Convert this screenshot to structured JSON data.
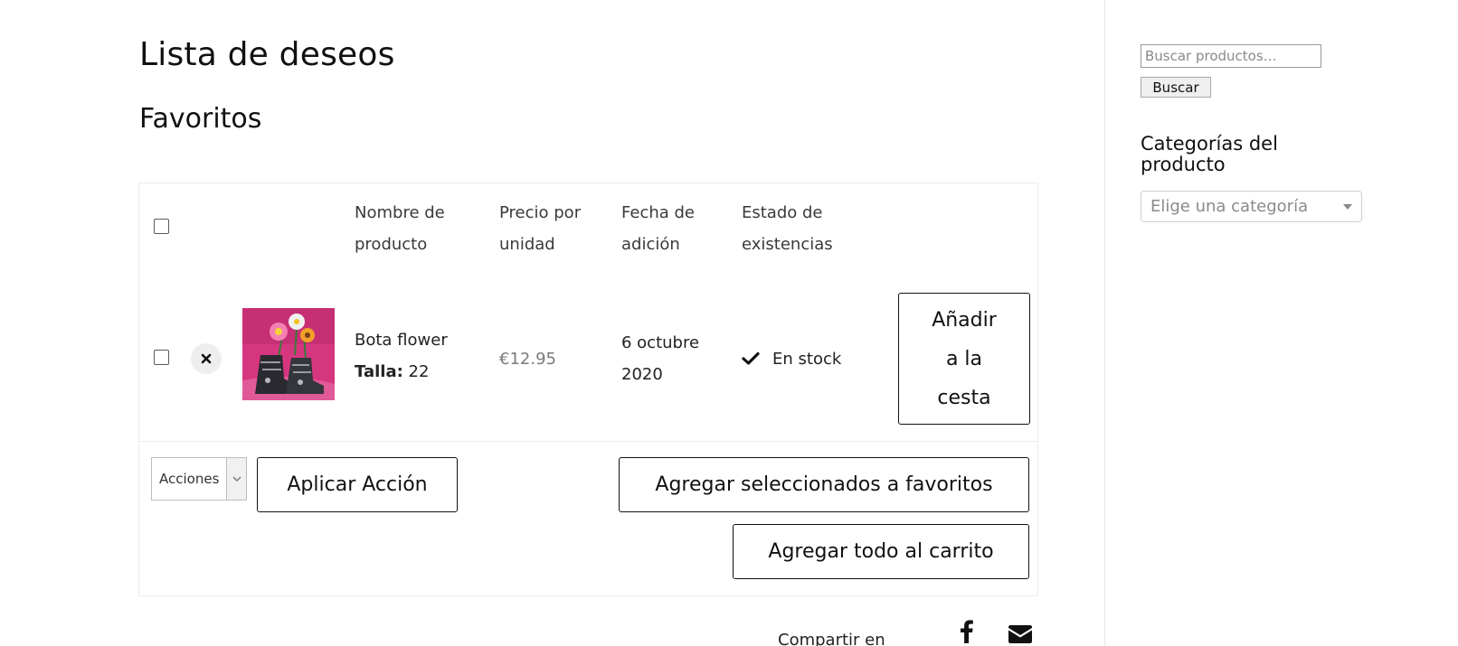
{
  "page": {
    "title": "Lista de deseos"
  },
  "wishlist": {
    "name": "Favoritos",
    "headers": {
      "product_name": [
        "Nombre de",
        "producto"
      ],
      "unit_price": [
        "Precio por",
        "unidad"
      ],
      "date_added": [
        "Fecha de",
        "adición"
      ],
      "stock_status": [
        "Estado de",
        "existencias"
      ]
    },
    "items": [
      {
        "name": "Bota flower",
        "attribute_label": "Talla:",
        "attribute_value": "22",
        "price": "€12.95",
        "date_added": [
          "6 octubre",
          "2020"
        ],
        "stock": "En stock",
        "add_to_cart_label": [
          "Añadir",
          "a la",
          "cesta"
        ]
      }
    ],
    "bulk_actions": {
      "select_value": "Acciones",
      "apply_label": "Aplicar Acción",
      "add_selected_label": "Agregar seleccionados a favoritos",
      "add_all_label": "Agregar todo al carrito"
    },
    "share": {
      "label": "Compartir en",
      "icons": [
        "facebook-icon",
        "email-icon"
      ]
    }
  },
  "sidebar": {
    "search": {
      "placeholder": "Buscar productos…",
      "button_label": "Buscar"
    },
    "categories": {
      "title": "Categorías del producto",
      "select_placeholder": "Elige una categoría"
    }
  },
  "colors": {
    "text": "#111111",
    "border_light": "#ececec",
    "price_gray": "#7a7a7a",
    "remove_bg": "#eeeeee",
    "thumb_pink": "#d6367f"
  }
}
